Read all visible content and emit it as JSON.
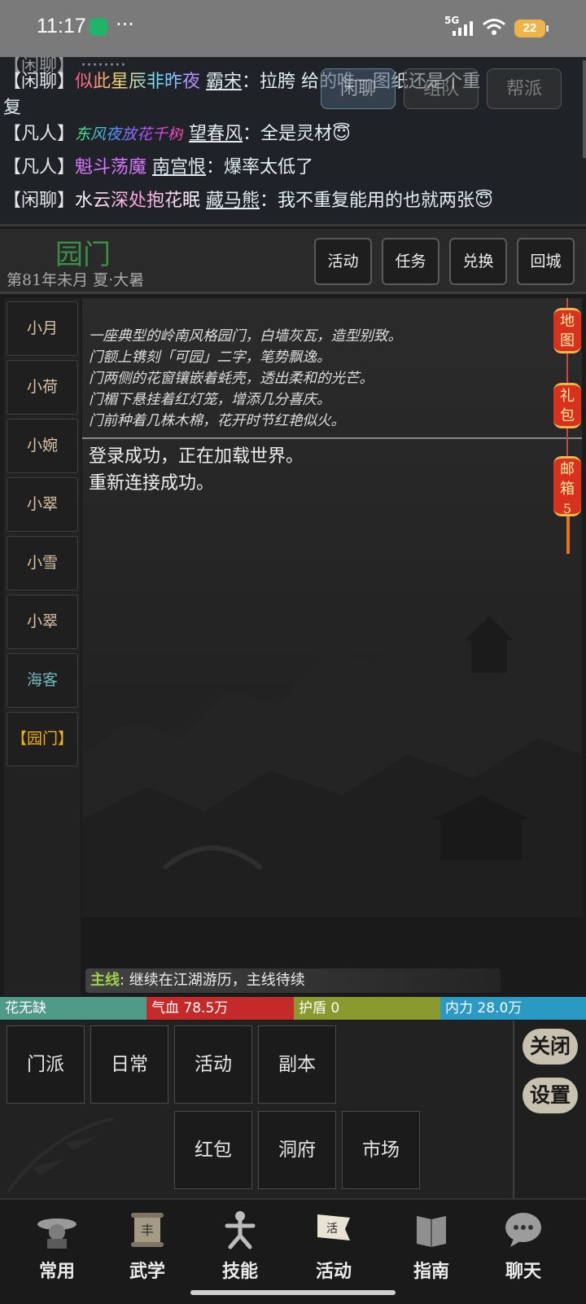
{
  "status_bar": {
    "time": "11:17",
    "dots": "···",
    "network": "5G",
    "battery": "22"
  },
  "chat": {
    "tabs": [
      "闲聊",
      "组队",
      "帮派"
    ],
    "messages": [
      {
        "channel": "【闲聊】",
        "title": "似此星辰非昨夜",
        "sender": "霸宋",
        "text": "：拉胯 给的唯一图纸还是个重"
      },
      {
        "channel": "",
        "title": "",
        "sender": "",
        "text": "复"
      },
      {
        "channel": "【凡人】",
        "title": "东风夜放花千树",
        "sender": "望春风",
        "text": "：全是灵材😇"
      },
      {
        "channel": "【凡人】",
        "title": "魁斗荡魔",
        "sender": "南宫恨",
        "text": "：爆率太低了"
      },
      {
        "channel": "【闲聊】",
        "title": "水云深处抱花眠",
        "sender": "藏马熊",
        "text": "：我不重复能用的也就两张😇"
      }
    ]
  },
  "location": {
    "name": "园门",
    "date": "第81年未月 夏·大暑",
    "buttons": [
      "活动",
      "任务",
      "兑换",
      "回城"
    ]
  },
  "npcs": [
    "小月",
    "小荷",
    "小婉",
    "小翠",
    "小雪",
    "小翠",
    "海客",
    "【园门】"
  ],
  "scene": {
    "description": [
      "一座典型的岭南风格园门，白墙灰瓦，造型别致。",
      "门额上镌刻「可园」二字，笔势飘逸。",
      "门两侧的花窗镶嵌着蚝壳，透出柔和的光芒。",
      "门楣下悬挂着红灯笼，增添几分喜庆。",
      "门前种着几株木棉，花开时节红艳似火。"
    ],
    "log": [
      "登录成功，正在加载世界。",
      "重新连接成功。"
    ],
    "quest_tag": "主线",
    "quest_text": ": 继续在江湖游历，主线待续"
  },
  "lanterns": [
    {
      "label": "地图",
      "count": ""
    },
    {
      "label": "礼包",
      "count": ""
    },
    {
      "label": "邮箱",
      "count": "5"
    }
  ],
  "stats": {
    "name": "花无缺",
    "hp_label": "气血",
    "hp": "78.5万",
    "shield_label": "护盾",
    "shield": "0",
    "mp_label": "内力",
    "mp": "28.0万"
  },
  "menu": {
    "row1": [
      "门派",
      "日常",
      "活动",
      "副本"
    ],
    "row2": [
      "红包",
      "洞府",
      "市场"
    ],
    "close": "关闭",
    "settings": "设置"
  },
  "nav": [
    {
      "label": "常用",
      "icon": "hat-icon"
    },
    {
      "label": "武学",
      "icon": "scroll-icon"
    },
    {
      "label": "技能",
      "icon": "martial-figure-icon"
    },
    {
      "label": "活动",
      "icon": "banner-icon"
    },
    {
      "label": "指南",
      "icon": "book-icon"
    },
    {
      "label": "聊天",
      "icon": "chat-bubble-icon"
    }
  ]
}
